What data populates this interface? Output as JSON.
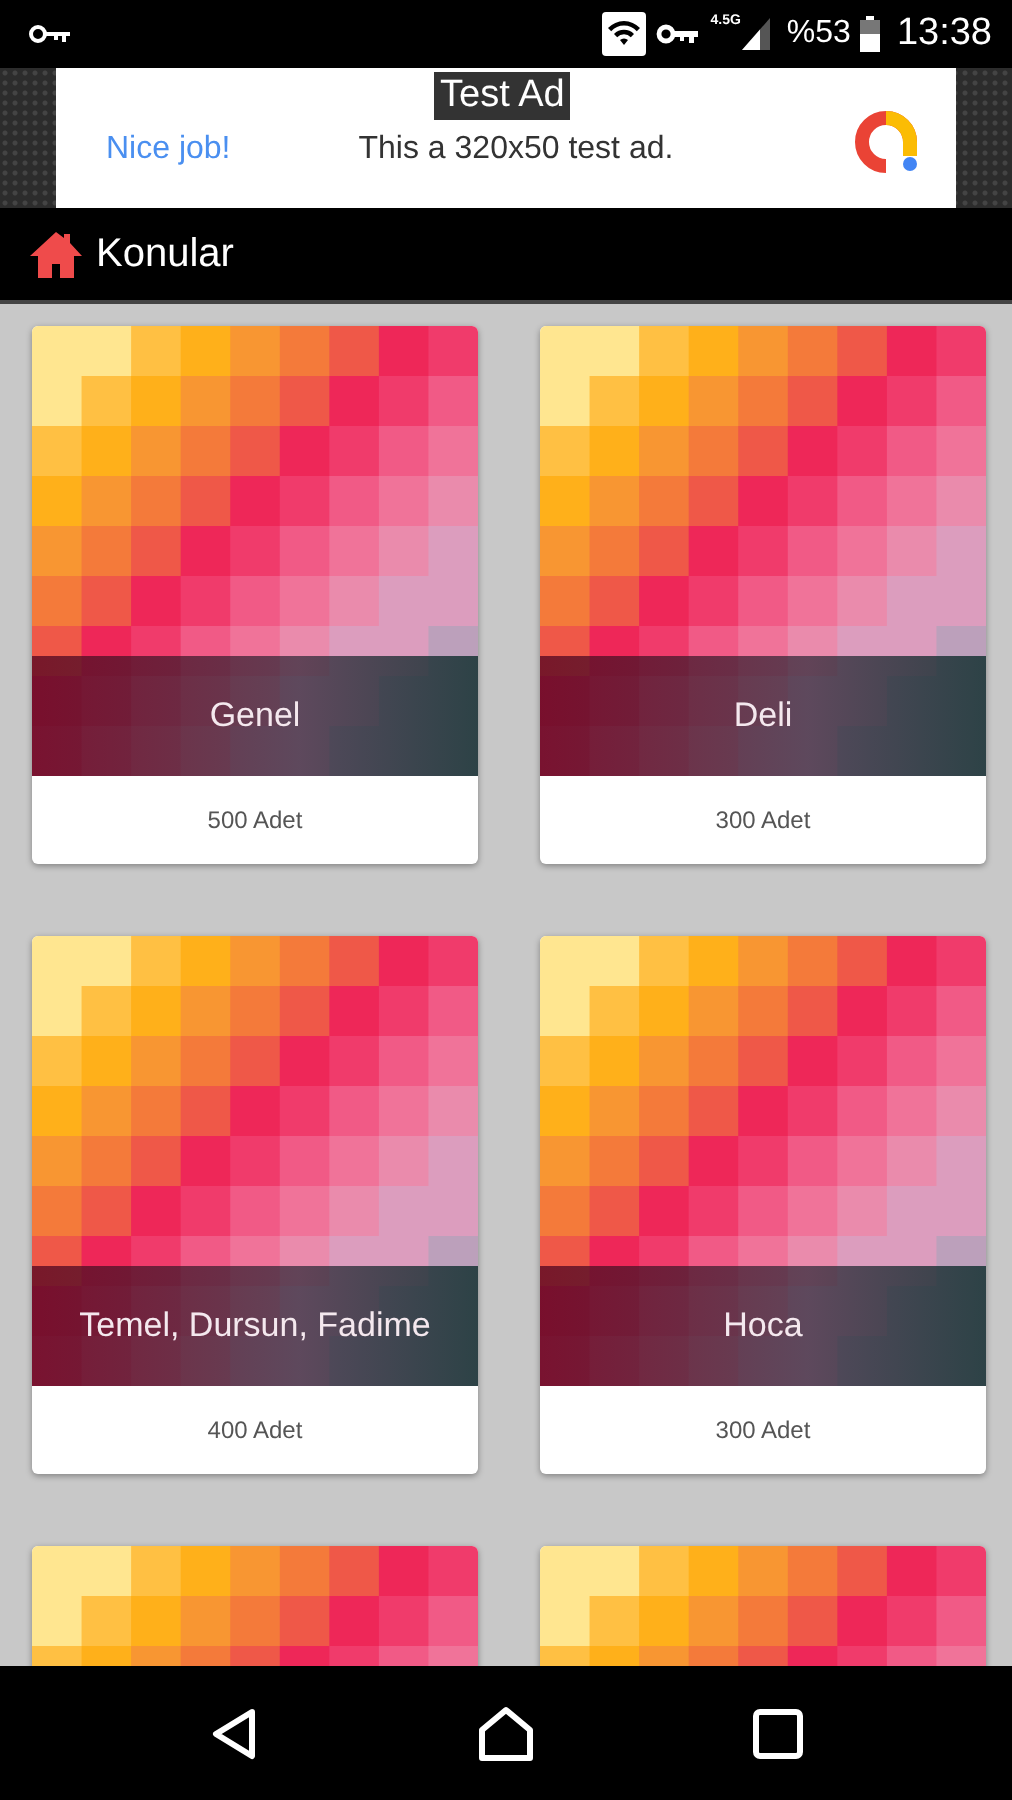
{
  "status_bar": {
    "network": "4.5G",
    "battery": "%53",
    "time": "13:38"
  },
  "ad": {
    "label": "Test Ad",
    "headline": "Nice job!",
    "body": "This a 320x50 test ad."
  },
  "toolbar": {
    "title": "Konular"
  },
  "cards": [
    {
      "kind": "topic",
      "title": "Genel",
      "count": "500 Adet"
    },
    {
      "kind": "topic",
      "title": "Deli",
      "count": "300 Adet"
    },
    {
      "kind": "topic",
      "title": "Temel, Dursun, Fadime",
      "count": "400 Adet"
    },
    {
      "kind": "topic",
      "title": "Hoca",
      "count": "300 Adet"
    },
    {
      "kind": "picture"
    },
    {
      "kind": "picture"
    }
  ]
}
